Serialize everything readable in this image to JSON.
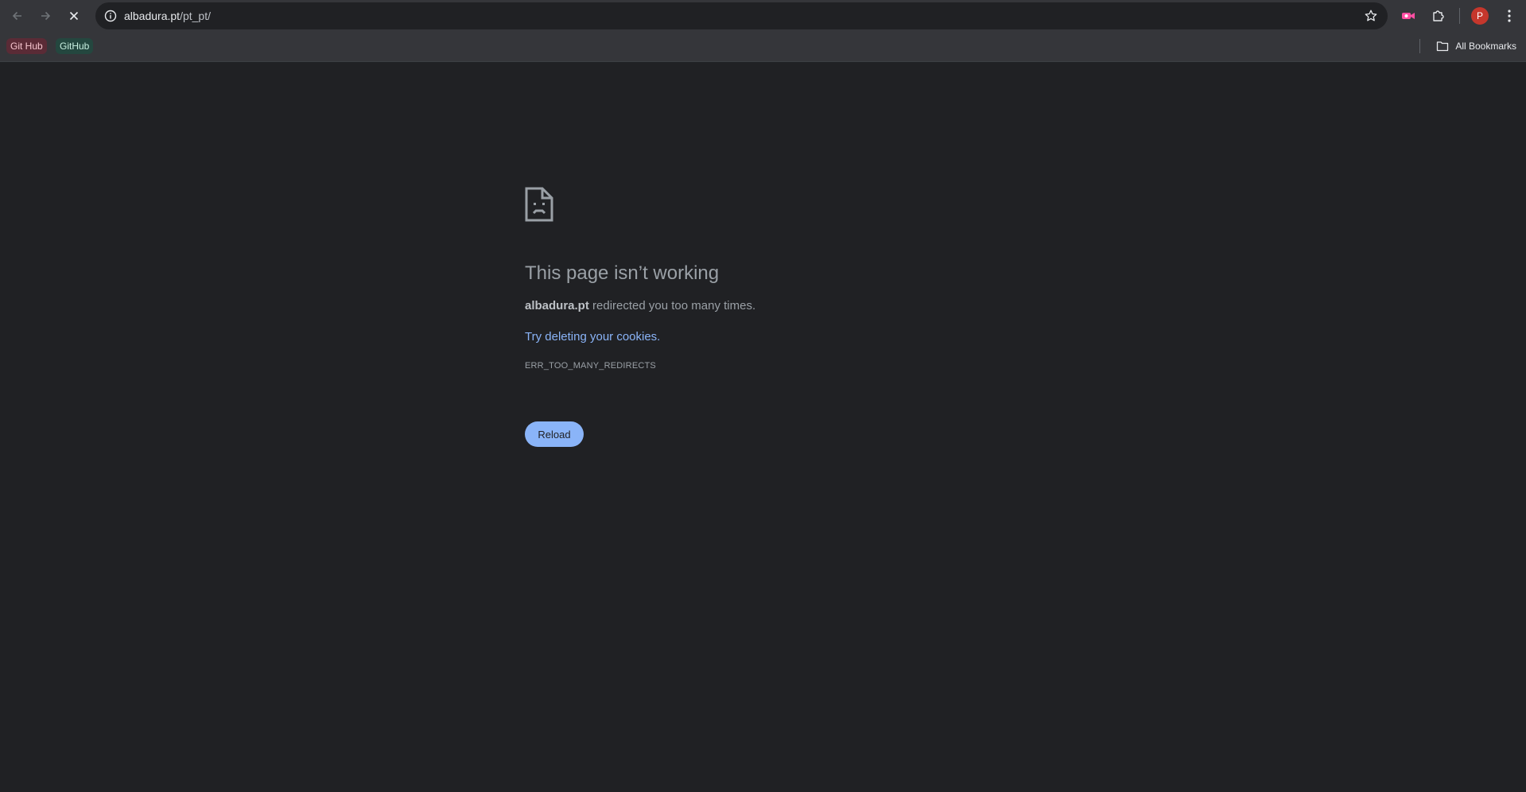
{
  "toolbar": {
    "back_icon": "arrow-left-icon",
    "forward_icon": "arrow-right-icon",
    "stop_icon": "close-icon",
    "url_host": "albadura.pt",
    "url_path": "/pt_pt/",
    "avatar_letter": "P"
  },
  "bookmarks": {
    "items": [
      {
        "label": "Git Hub"
      },
      {
        "label": "GitHub"
      }
    ],
    "all_bookmarks_label": "All Bookmarks"
  },
  "error": {
    "title": "This page isn’t working",
    "host": "albadura.pt",
    "message": " redirected you too many times.",
    "suggestion": "Try deleting your cookies.",
    "code": "ERR_TOO_MANY_REDIRECTS",
    "reload_label": "Reload"
  },
  "colors": {
    "page_background": "#202124",
    "chrome_background": "#35363a",
    "link": "#8ab4f8",
    "button": "#8ab4f8",
    "avatar": "#c5372c"
  }
}
